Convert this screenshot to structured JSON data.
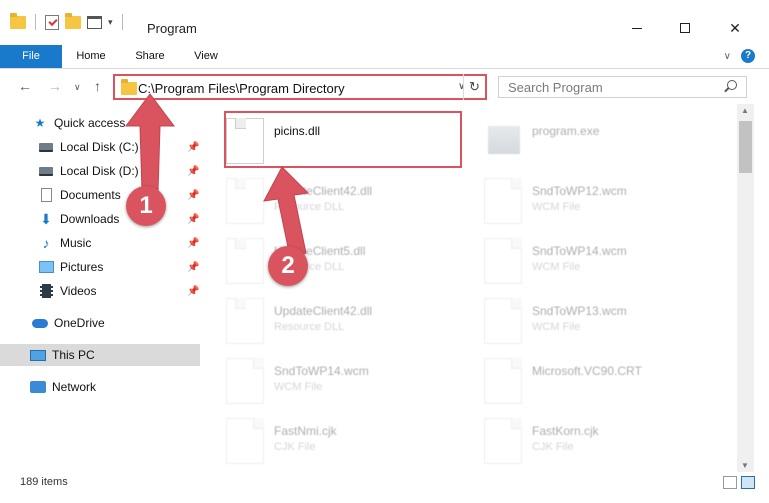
{
  "window": {
    "title": "Program",
    "minimize": "—",
    "maximize": "☐",
    "close": "✕"
  },
  "ribbon": {
    "tabs": [
      "File",
      "Home",
      "Share",
      "View"
    ],
    "expand": "∨",
    "help": "?"
  },
  "nav_buttons": {
    "back": "←",
    "forward": "→",
    "dropdown": "∨",
    "up": "↑"
  },
  "address": {
    "path": "C:\\Program Files\\Program Directory",
    "dropdown": "∨",
    "refresh": "↻"
  },
  "search": {
    "placeholder": "Search Program"
  },
  "sidebar": {
    "items": [
      {
        "label": "Quick access",
        "icon": "star-icon",
        "pinned": false
      },
      {
        "label": "Local Disk (C:)",
        "icon": "drive-icon",
        "pinned": true
      },
      {
        "label": "Local Disk (D:)",
        "icon": "drive-icon",
        "pinned": true
      },
      {
        "label": "Documents",
        "icon": "documents-icon",
        "pinned": true
      },
      {
        "label": "Downloads",
        "icon": "downloads-icon",
        "pinned": true
      },
      {
        "label": "Music",
        "icon": "music-icon",
        "pinned": true
      },
      {
        "label": "Pictures",
        "icon": "pictures-icon",
        "pinned": true
      },
      {
        "label": "Videos",
        "icon": "videos-icon",
        "pinned": true
      },
      {
        "label": "OneDrive",
        "icon": "onedrive-icon",
        "pinned": false
      },
      {
        "label": "This PC",
        "icon": "this-pc-icon",
        "pinned": false,
        "selected": true
      },
      {
        "label": "Network",
        "icon": "network-icon",
        "pinned": false
      }
    ]
  },
  "files": [
    {
      "name": "picins.dll",
      "type": "",
      "icon": "dll-icon",
      "faded": false
    },
    {
      "name": "program.exe",
      "type": "",
      "icon": "exe-icon",
      "faded": true
    },
    {
      "name": "UpdateClient42.dll",
      "type": "Resource DLL",
      "icon": "dll-icon",
      "faded": true
    },
    {
      "name": "SndToWP12.wcm",
      "type": "WCM File",
      "icon": "file-icon",
      "faded": true
    },
    {
      "name": "UpdateClient5.dll",
      "type": "Resource DLL",
      "icon": "dll-icon",
      "faded": true
    },
    {
      "name": "SndToWP14.wcm",
      "type": "WCM File",
      "icon": "file-icon",
      "faded": true
    },
    {
      "name": "UpdateClient42.dll",
      "type": "Resource DLL",
      "icon": "dll-icon",
      "faded": true
    },
    {
      "name": "SndToWP13.wcm",
      "type": "WCM File",
      "icon": "file-icon",
      "faded": true
    },
    {
      "name": "SndToWP14.wcm",
      "type": "WCM File",
      "icon": "file-icon",
      "faded": true
    },
    {
      "name": "Microsoft.VC90.CRT",
      "type": "",
      "icon": "file-icon",
      "faded": true
    },
    {
      "name": "FastNmi.cjk",
      "type": "CJK File",
      "icon": "file-icon",
      "faded": true
    },
    {
      "name": "FastKorn.cjk",
      "type": "CJK File",
      "icon": "file-icon",
      "faded": true
    }
  ],
  "status": {
    "item_count": "189 items"
  },
  "callouts": {
    "step1": "1",
    "step2": "2"
  },
  "colors": {
    "accent": "#1979ca",
    "callout": "#d9545f",
    "selected_bg": "#dadada"
  }
}
